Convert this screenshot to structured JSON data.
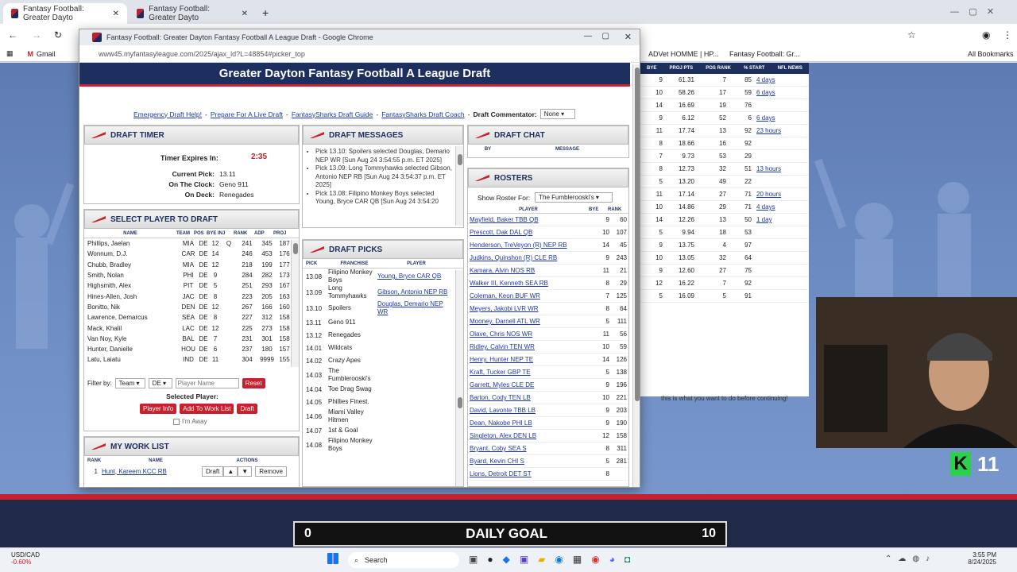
{
  "browser": {
    "tabs": [
      {
        "title": "Fantasy Football: Greater Dayto"
      },
      {
        "title": "Fantasy Football: Greater Dayto"
      }
    ],
    "url": "",
    "bookmarks": [
      {
        "label": "Gmail"
      },
      {
        "label": "ADVet HOMME | HP..."
      },
      {
        "label": "Fantasy Football: Gr..."
      }
    ],
    "all_bookmarks": "All Bookmarks"
  },
  "popup": {
    "title": "Fantasy Football: Greater Dayton Fantasy Football A League Draft - Google Chrome",
    "url": "www45.myfantasyleague.com/2025/ajax_ld?L=48854#picker_top",
    "banner": "Greater Dayton Fantasy Football A League Draft",
    "links": {
      "emergency": "Emergency Draft Help!",
      "prepare": "Prepare For A Live Draft",
      "guide": "FantasySharks Draft Guide",
      "coach": "FantasySharks Draft Coach",
      "commentator_label": "Draft Commentator:",
      "commentator_value": "None"
    }
  },
  "timer": {
    "heading": "DRAFT TIMER",
    "expires_label": "Timer Expires In:",
    "expires_value": "2:35",
    "current_label": "Current Pick:",
    "current_value": "13.11",
    "clock_label": "On The Clock:",
    "clock_value": "Geno 911",
    "deck_label": "On Deck:",
    "deck_value": "Renegades"
  },
  "select_player": {
    "heading": "SELECT PLAYER TO DRAFT",
    "columns": [
      "NAME",
      "TEAM",
      "POS",
      "BYE",
      "INJ",
      "RANK",
      "ADP",
      "PROJ"
    ],
    "rows": [
      [
        "Phillips, Jaelan",
        "MIA",
        "DE",
        "12",
        "Q",
        "241",
        "345",
        "187"
      ],
      [
        "Wonnum, D.J.",
        "CAR",
        "DE",
        "14",
        "",
        "246",
        "453",
        "176"
      ],
      [
        "Chubb, Bradley",
        "MIA",
        "DE",
        "12",
        "",
        "218",
        "199",
        "177"
      ],
      [
        "Smith, Nolan",
        "PHI",
        "DE",
        "9",
        "",
        "284",
        "282",
        "173"
      ],
      [
        "Highsmith, Alex",
        "PIT",
        "DE",
        "5",
        "",
        "251",
        "293",
        "167"
      ],
      [
        "Hines-Allen, Josh",
        "JAC",
        "DE",
        "8",
        "",
        "223",
        "205",
        "163"
      ],
      [
        "Bonitto, Nik",
        "DEN",
        "DE",
        "12",
        "",
        "267",
        "166",
        "160"
      ],
      [
        "Lawrence, Demarcus",
        "SEA",
        "DE",
        "8",
        "",
        "227",
        "312",
        "158"
      ],
      [
        "Mack, Khalil",
        "LAC",
        "DE",
        "12",
        "",
        "225",
        "273",
        "158"
      ],
      [
        "Van Noy, Kyle",
        "BAL",
        "DE",
        "7",
        "",
        "231",
        "301",
        "158"
      ],
      [
        "Hunter, Danielle",
        "HOU",
        "DE",
        "6",
        "",
        "237",
        "180",
        "157"
      ],
      [
        "Latu, Laiatu",
        "IND",
        "DE",
        "11",
        "",
        "304",
        "9999",
        "155"
      ]
    ],
    "filter_label": "Filter by:",
    "filter_team": "Team",
    "filter_pos": "DE",
    "player_name_placeholder": "Player Name",
    "reset": "Reset",
    "selected_label": "Selected Player:",
    "player_info": "Player Info",
    "add_work": "Add To Work List",
    "draft": "Draft",
    "away": "I'm Away"
  },
  "work_list": {
    "heading": "MY WORK LIST",
    "columns": [
      "RANK",
      "NAME",
      "ACTIONS"
    ],
    "rows": [
      {
        "rank": "1",
        "name": "Hunt, Kareem KCC RB",
        "draft": "Draft",
        "up": "▲",
        "down": "▼",
        "remove": "Remove"
      }
    ]
  },
  "messages": {
    "heading": "DRAFT MESSAGES",
    "items": [
      "Pick 13.10: Spoilers selected Douglas, Demario NEP WR [Sun Aug 24 3:54:55 p.m. ET 2025]",
      "Pick 13.09: Long Tommyhawks selected Gibson, Antonio NEP RB [Sun Aug 24 3:54:37 p.m. ET 2025]",
      "Pick 13.08: Filipino Monkey Boys selected Young, Bryce CAR QB [Sun Aug 24 3:54:20"
    ]
  },
  "picks": {
    "heading": "DRAFT PICKS",
    "columns": [
      "PICK",
      "FRANCHISE",
      "PLAYER"
    ],
    "rows": [
      {
        "pick": "13.08",
        "team": "Filipino Monkey Boys",
        "player": "Young, Bryce CAR QB"
      },
      {
        "pick": "13.09",
        "team": "Long Tommyhawks",
        "player": "Gibson, Antonio NEP RB"
      },
      {
        "pick": "13.10",
        "team": "Spoilers",
        "player": "Douglas, Demario NEP WR"
      },
      {
        "pick": "13.11",
        "team": "Geno 911",
        "player": ""
      },
      {
        "pick": "13.12",
        "team": "Renegades",
        "player": ""
      },
      {
        "pick": "14.01",
        "team": "Wildcats",
        "player": ""
      },
      {
        "pick": "14.02",
        "team": "Crazy Apes",
        "player": ""
      },
      {
        "pick": "14.03",
        "team": "The Fumblerooski's",
        "player": ""
      },
      {
        "pick": "14.04",
        "team": "Toe Drag Swag",
        "player": ""
      },
      {
        "pick": "14.05",
        "team": "Phillies Finest.",
        "player": ""
      },
      {
        "pick": "14.06",
        "team": "Miami Valley Hitmen",
        "player": ""
      },
      {
        "pick": "14.07",
        "team": "1st & Goal",
        "player": ""
      },
      {
        "pick": "14.08",
        "team": "Filipino Monkey Boys",
        "player": ""
      }
    ]
  },
  "chat": {
    "heading": "DRAFT CHAT",
    "columns": [
      "BY",
      "MESSAGE"
    ]
  },
  "rosters": {
    "heading": "ROSTERS",
    "show_label": "Show Roster For:",
    "show_value": "The Fumblerooski's",
    "columns": [
      "PLAYER",
      "BYE",
      "RANK"
    ],
    "rows": [
      [
        "Mayfield, Baker TBB QB",
        "9",
        "60"
      ],
      [
        "Prescott, Dak DAL QB",
        "10",
        "107"
      ],
      [
        "Henderson, TreVeyon (R) NEP RB",
        "14",
        "45"
      ],
      [
        "Judkins, Quinshon (R) CLE RB",
        "9",
        "243"
      ],
      [
        "Kamara, Alvin NOS RB",
        "11",
        "21"
      ],
      [
        "Walker III, Kenneth SEA RB",
        "8",
        "29"
      ],
      [
        "Coleman, Keon BUF WR",
        "7",
        "125"
      ],
      [
        "Meyers, Jakobi LVR WR",
        "8",
        "64"
      ],
      [
        "Mooney, Darnell ATL WR",
        "5",
        "111"
      ],
      [
        "Olave, Chris NOS WR",
        "11",
        "56"
      ],
      [
        "Ridley, Calvin TEN WR",
        "10",
        "59"
      ],
      [
        "Henry, Hunter NEP TE",
        "14",
        "126"
      ],
      [
        "Kraft, Tucker GBP TE",
        "5",
        "138"
      ],
      [
        "Garrett, Myles CLE DE",
        "9",
        "196"
      ],
      [
        "Barton, Cody TEN LB",
        "10",
        "221"
      ],
      [
        "David, Lavonte TBB LB",
        "9",
        "203"
      ],
      [
        "Dean, Nakobe PHI LB",
        "9",
        "190"
      ],
      [
        "Singleton, Alex DEN LB",
        "12",
        "158"
      ],
      [
        "Bryant, Coby SEA S",
        "8",
        "311"
      ],
      [
        "Byard, Kevin CHI S",
        "5",
        "281"
      ],
      [
        "Lions, Detroit DET ST",
        "8",
        ""
      ]
    ]
  },
  "right_table": {
    "columns": [
      "BYE",
      "PROJ PTS",
      "POS RANK",
      "% START",
      "NFL NEWS"
    ],
    "rows": [
      [
        "9",
        "61.31",
        "7",
        "85",
        "4 days"
      ],
      [
        "10",
        "58.26",
        "17",
        "59",
        "6 days"
      ],
      [
        "14",
        "16.69",
        "19",
        "76",
        ""
      ],
      [
        "9",
        "6.12",
        "52",
        "6",
        "6 days"
      ],
      [
        "11",
        "17.74",
        "13",
        "92",
        "23 hours"
      ],
      [
        "8",
        "18.66",
        "16",
        "92",
        ""
      ],
      [
        "7",
        "9.73",
        "53",
        "29",
        ""
      ],
      [
        "8",
        "12.73",
        "32",
        "51",
        "13 hours"
      ],
      [
        "5",
        "13.20",
        "49",
        "22",
        ""
      ],
      [
        "11",
        "17.14",
        "27",
        "71",
        "20 hours"
      ],
      [
        "10",
        "14.86",
        "29",
        "71",
        "4 days"
      ],
      [
        "14",
        "12.26",
        "13",
        "50",
        "1 day"
      ],
      [
        "5",
        "9.94",
        "18",
        "53",
        ""
      ],
      [
        "9",
        "13.75",
        "4",
        "97",
        ""
      ],
      [
        "10",
        "13.05",
        "32",
        "64",
        ""
      ],
      [
        "9",
        "12.60",
        "27",
        "75",
        ""
      ],
      [
        "12",
        "16.22",
        "7",
        "92",
        ""
      ],
      [
        "5",
        "16.09",
        "5",
        "91",
        ""
      ]
    ],
    "continue_text": "this is what you want to do before continuing!"
  },
  "overlay": {
    "goal_left": "0",
    "goal_label": "DAILY GOAL",
    "goal_right": "10",
    "k_count": "11"
  },
  "taskbar": {
    "ticker": "USD/CAD",
    "ticker_change": "-0.60%",
    "search": "Search",
    "time": "3:55 PM",
    "date": "8/24/2025"
  }
}
